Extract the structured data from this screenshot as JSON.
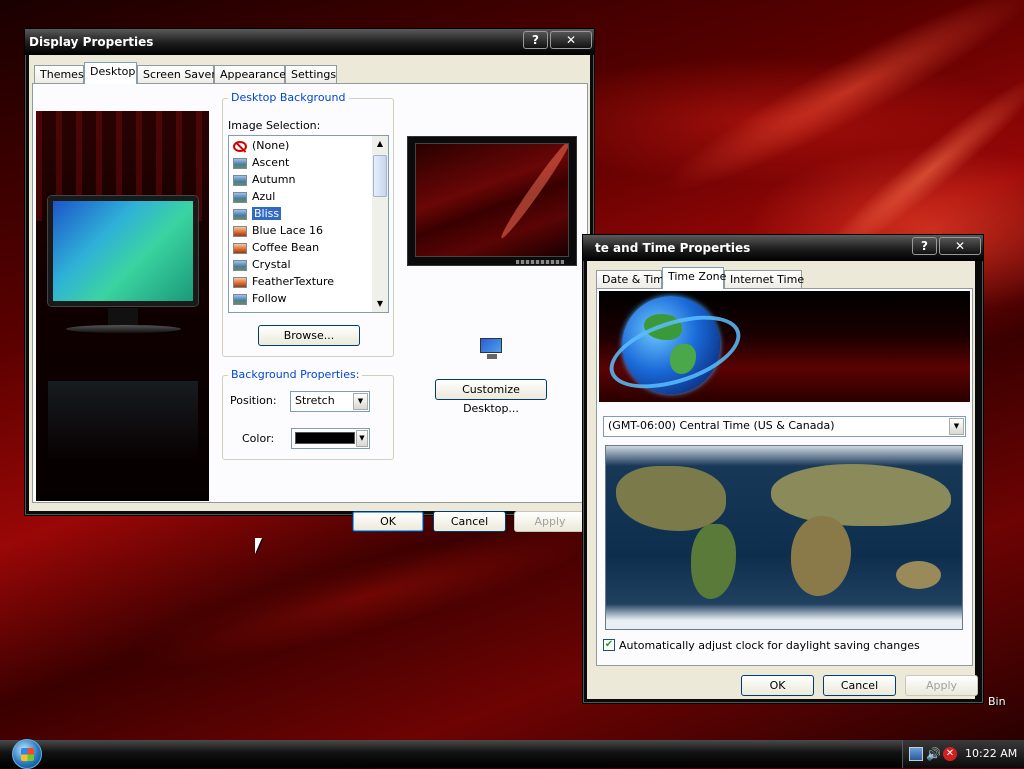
{
  "display": {
    "title": "Display Properties",
    "help_btn": "?",
    "close_btn": "✕",
    "tabs": [
      "Themes",
      "Desktop",
      "Screen Saver",
      "Appearance",
      "Settings"
    ],
    "active_tab": "Desktop",
    "background_group": "Desktop Background",
    "image_selection_label": "Image Selection:",
    "images": [
      {
        "label": "(None)",
        "icon": "no-image-icon"
      },
      {
        "label": "Ascent",
        "icon": "image-thumb-icon"
      },
      {
        "label": "Autumn",
        "icon": "image-thumb-icon"
      },
      {
        "label": "Azul",
        "icon": "image-thumb-icon"
      },
      {
        "label": "Bliss",
        "icon": "image-thumb-icon",
        "selected": true
      },
      {
        "label": "Blue Lace 16",
        "icon": "bitmap-thumb-icon"
      },
      {
        "label": "Coffee Bean",
        "icon": "bitmap-thumb-icon"
      },
      {
        "label": "Crystal",
        "icon": "image-thumb-icon"
      },
      {
        "label": "FeatherTexture",
        "icon": "bitmap-thumb-icon"
      },
      {
        "label": "Follow",
        "icon": "image-thumb-icon"
      }
    ],
    "browse_button": "Browse...",
    "properties_group": "Background Properties:",
    "position_label": "Position:",
    "position_value": "Stretch",
    "color_label": "Color:",
    "color_value": "#000000",
    "customize_button": "Customize Desktop...",
    "ok": "OK",
    "cancel": "Cancel",
    "apply": "Apply"
  },
  "datetime": {
    "title": "te and Time Properties",
    "help_btn": "?",
    "close_btn": "✕",
    "tabs": [
      "Date & Time",
      "Time Zone",
      "Internet Time"
    ],
    "active_tab": "Time Zone",
    "timezone": "(GMT-06:00) Central Time (US & Canada)",
    "dst_checkbox_label": "Automatically adjust clock for daylight saving changes",
    "dst_checked": true,
    "ok": "OK",
    "cancel": "Cancel",
    "apply": "Apply"
  },
  "desktop": {
    "recycle_label": "Bin"
  },
  "taskbar": {
    "start_icon": "windows-orb-icon",
    "tray_icons": [
      "network-icon",
      "volume-icon",
      "security-alert-icon"
    ],
    "clock": "10:22 AM"
  },
  "colors": {
    "selection": "#316ac5",
    "group_legend": "#0046d5",
    "dialog_face": "#ece9d8"
  }
}
